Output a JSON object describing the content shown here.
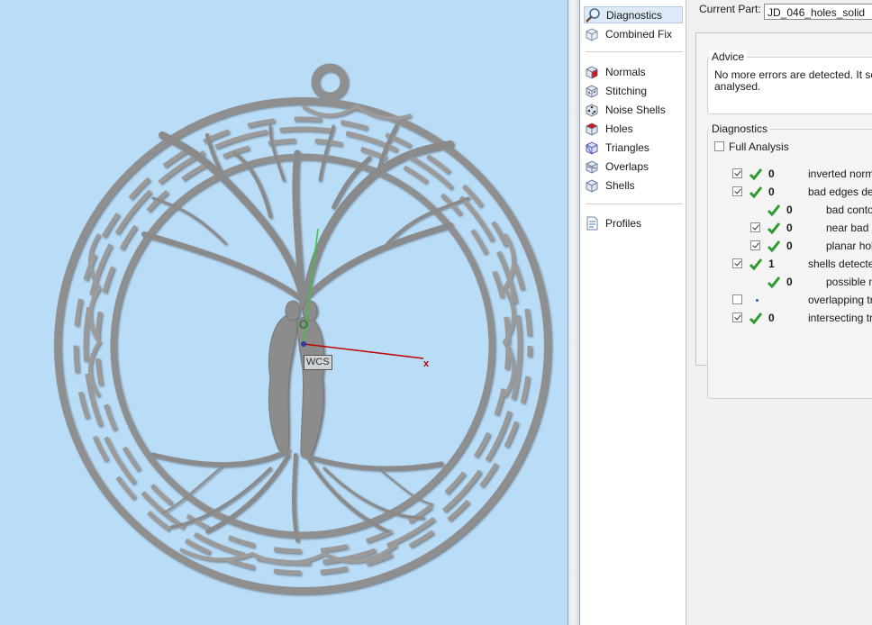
{
  "viewport": {
    "wcs_label": "WCS",
    "x_axis_label": "x"
  },
  "nav": {
    "items": [
      {
        "label": "Diagnostics",
        "icon": "magnifier-icon",
        "selected": true
      },
      {
        "label": "Combined Fix",
        "icon": "combined-fix-icon"
      },
      {
        "label": "Normals",
        "icon": "normals-cube-icon"
      },
      {
        "label": "Stitching",
        "icon": "stitching-cube-icon"
      },
      {
        "label": "Noise Shells",
        "icon": "noise-shells-cube-icon"
      },
      {
        "label": "Holes",
        "icon": "holes-cube-icon"
      },
      {
        "label": "Triangles",
        "icon": "triangles-cube-icon"
      },
      {
        "label": "Overlaps",
        "icon": "overlaps-cube-icon"
      },
      {
        "label": "Shells",
        "icon": "shells-cube-icon"
      },
      {
        "label": "Profiles",
        "icon": "profiles-document-icon"
      }
    ]
  },
  "page": {
    "current_part_label": "Current Part:",
    "current_part_value": "JD_046_holes_solid",
    "advice": {
      "title": "Advice",
      "line1": "No more errors are detected. It see",
      "line2": "analysed."
    },
    "diagnostics": {
      "title": "Diagnostics",
      "full_analysis_label": "Full Analysis",
      "rows": [
        {
          "count": "0",
          "label": "inverted norma",
          "checked": true
        },
        {
          "count": "0",
          "label": "bad edges dete",
          "checked": true
        },
        {
          "count": "0",
          "label": "bad contou",
          "checked": null
        },
        {
          "count": "0",
          "label": "near bad e",
          "checked": true
        },
        {
          "count": "0",
          "label": "planar hole",
          "checked": true
        },
        {
          "count": "1",
          "label": "shells detected",
          "checked": true
        },
        {
          "count": "0",
          "label": "possible no",
          "checked": null
        },
        {
          "count": "",
          "label": "overlapping tria",
          "checked": false
        },
        {
          "count": "0",
          "label": "intersecting tria",
          "checked": true
        }
      ]
    }
  },
  "colors": {
    "viewport_bg": "#b9dcf7",
    "model_gray": "#8f8f8f",
    "tick_green": "#2e9a2e",
    "x_axis_red": "#c00000",
    "y_axis_green": "#3cc43c"
  }
}
